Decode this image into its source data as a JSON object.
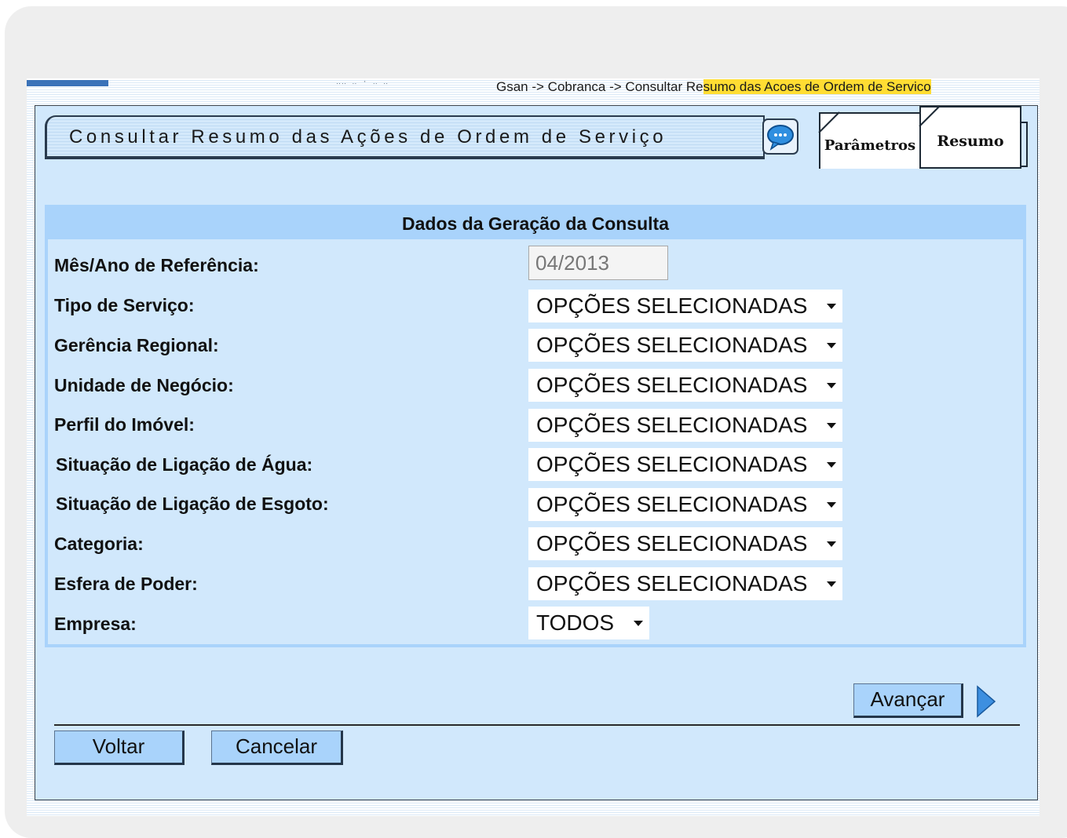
{
  "breadcrumb": {
    "prefix": "Gsan -> Cobranca -> Consultar Re",
    "highlight": "sumo das Acoes de Ordem de Servico"
  },
  "header": {
    "title": "Consultar Resumo das Ações de Ordem de Serviço",
    "help_icon": "chat-bubble-icon"
  },
  "tabs": [
    {
      "label": "Parâmetros"
    },
    {
      "label": "Resumo"
    }
  ],
  "form": {
    "heading": "Dados da Geração da Consulta",
    "reference": {
      "label": "Mês/Ano de Referência:",
      "value": "04/2013"
    },
    "fields": [
      {
        "label": "Tipo de Serviço:",
        "value": "OPÇÕES SELECIONADAS"
      },
      {
        "label": "Gerência Regional:",
        "value": "OPÇÕES SELECIONADAS"
      },
      {
        "label": "Unidade de Negócio:",
        "value": "OPÇÕES SELECIONADAS"
      },
      {
        "label": "Perfil do Imóvel:",
        "value": "OPÇÕES SELECIONADAS"
      },
      {
        "label": "Situação de Ligação de Água:",
        "value": "OPÇÕES SELECIONADAS"
      },
      {
        "label": "Situação de Ligação de Esgoto:",
        "value": "OPÇÕES SELECIONADAS"
      },
      {
        "label": "Categoria:",
        "value": "OPÇÕES SELECIONADAS"
      },
      {
        "label": "Esfera de Poder:",
        "value": "OPÇÕES SELECIONADAS"
      }
    ],
    "empresa": {
      "label": "Empresa:",
      "value": "TODOS"
    }
  },
  "buttons": {
    "next": "Avançar",
    "back": "Voltar",
    "cancel": "Cancelar"
  },
  "colors": {
    "panel_bg": "#d1e8fc",
    "header_bg": "#a9d3fb",
    "highlight": "#ffdd33",
    "icon_blue": "#2f8fe0"
  }
}
